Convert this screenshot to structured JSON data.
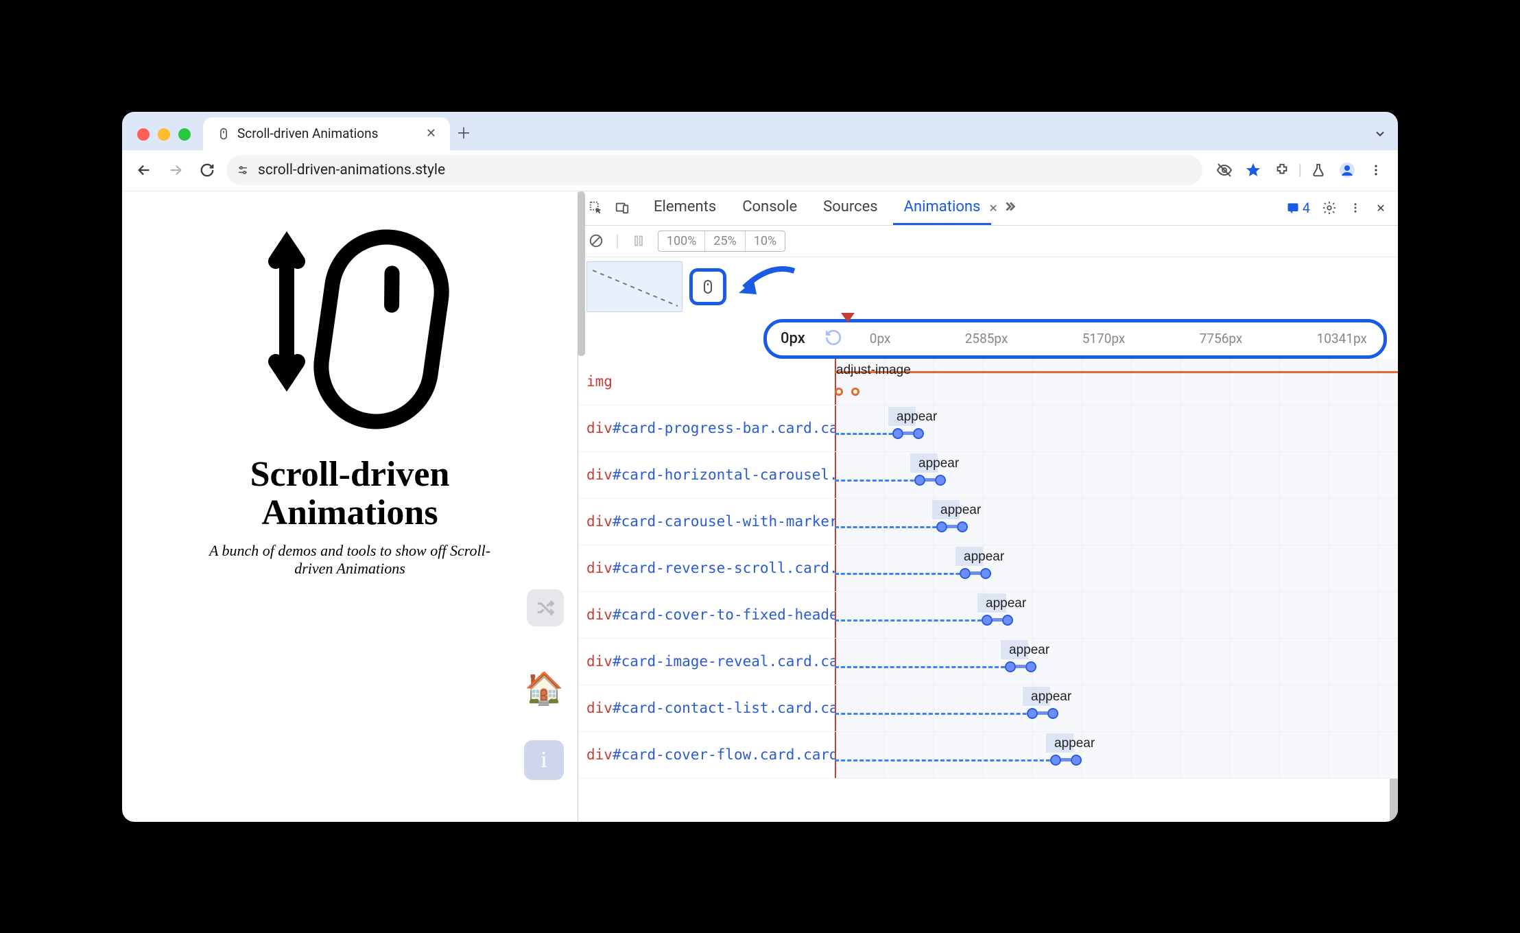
{
  "browser": {
    "tab_title": "Scroll-driven Animations",
    "url": "scroll-driven-animations.style"
  },
  "page": {
    "title_line1": "Scroll-driven",
    "title_line2": "Animations",
    "subtitle": "A bunch of demos and tools to show off Scroll-driven Animations"
  },
  "devtools": {
    "tabs": [
      "Elements",
      "Console",
      "Sources",
      "Animations"
    ],
    "active_tab": "Animations",
    "issues_count": "4",
    "speeds": [
      "100%",
      "25%",
      "10%"
    ],
    "ruler": {
      "current": "0px",
      "ticks": [
        "0px",
        "2585px",
        "5170px",
        "7756px",
        "10341px"
      ]
    },
    "rows": [
      {
        "tag": "img",
        "rest": "",
        "anim": "adjust-image",
        "offset": 0,
        "range": 42
      },
      {
        "tag": "div",
        "rest": "#card-progress-bar.card.ca",
        "anim": "appear",
        "offset": 84,
        "range": 40
      },
      {
        "tag": "div",
        "rest": "#card-horizontal-carousel.",
        "anim": "appear",
        "offset": 116,
        "range": 40
      },
      {
        "tag": "div",
        "rest": "#card-carousel-with-marker",
        "anim": "appear",
        "offset": 148,
        "range": 40
      },
      {
        "tag": "div",
        "rest": "#card-reverse-scroll.card.",
        "anim": "appear",
        "offset": 182,
        "range": 40
      },
      {
        "tag": "div",
        "rest": "#card-cover-to-fixed-heade",
        "anim": "appear",
        "offset": 214,
        "range": 42
      },
      {
        "tag": "div",
        "rest": "#card-image-reveal.card.ca",
        "anim": "appear",
        "offset": 248,
        "range": 40
      },
      {
        "tag": "div",
        "rest": "#card-contact-list.card.ca",
        "anim": "appear",
        "offset": 280,
        "range": 40
      },
      {
        "tag": "div",
        "rest": "#card-cover-flow.card.card",
        "anim": "appear",
        "offset": 314,
        "range": 40
      }
    ]
  }
}
